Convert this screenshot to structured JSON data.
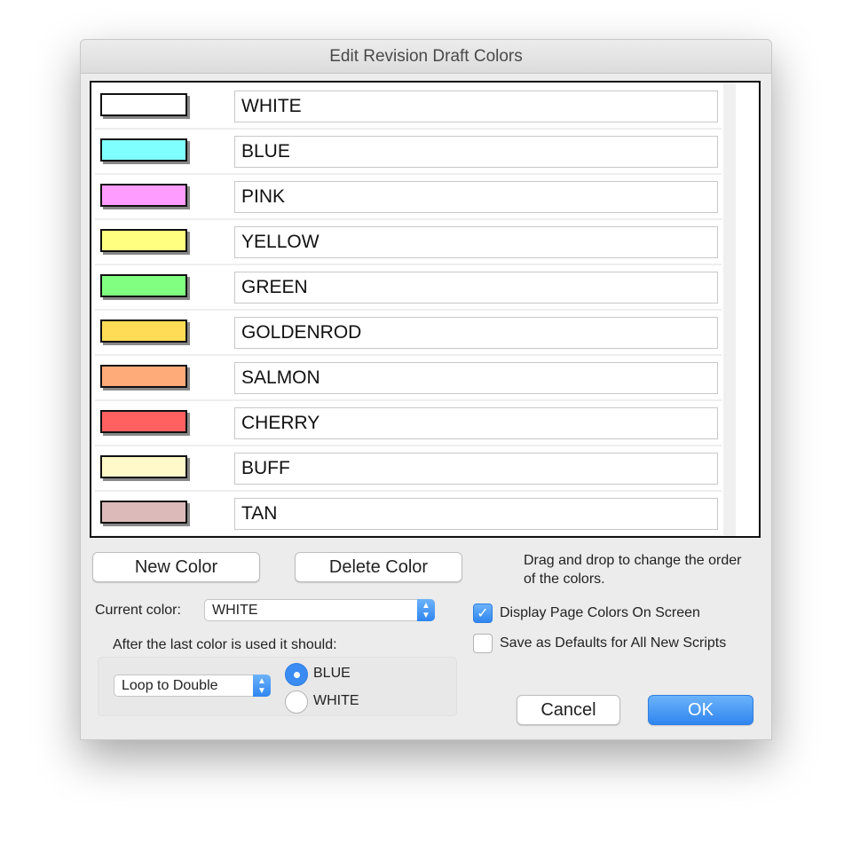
{
  "dialog": {
    "title": "Edit Revision Draft Colors"
  },
  "colors": [
    {
      "name": "WHITE",
      "swatch": "#ffffff"
    },
    {
      "name": "BLUE",
      "swatch": "#80ffff"
    },
    {
      "name": "PINK",
      "swatch": "#ff9cff"
    },
    {
      "name": "YELLOW",
      "swatch": "#ffff80"
    },
    {
      "name": "GREEN",
      "swatch": "#80ff80"
    },
    {
      "name": "GOLDENROD",
      "swatch": "#ffdc55"
    },
    {
      "name": "SALMON",
      "swatch": "#ffaa78"
    },
    {
      "name": "CHERRY",
      "swatch": "#ff6060"
    },
    {
      "name": "BUFF",
      "swatch": "#fff8c8"
    },
    {
      "name": "TAN",
      "swatch": "#dcbaba"
    }
  ],
  "buttons": {
    "new_color": "New Color",
    "delete_color": "Delete Color",
    "cancel": "Cancel",
    "ok": "OK"
  },
  "hint": "Drag and drop to change the order of the colors.",
  "current_color": {
    "label": "Current color:",
    "value": "WHITE"
  },
  "after_last": {
    "label": "After the last color is used it should:",
    "mode": "Loop to Double",
    "options": [
      {
        "label": "BLUE",
        "selected": true
      },
      {
        "label": "WHITE",
        "selected": false
      }
    ]
  },
  "checkboxes": [
    {
      "label": "Display Page Colors On Screen",
      "checked": true
    },
    {
      "label": "Save as Defaults for All New Scripts",
      "checked": false
    }
  ],
  "accent": "#2f85f0"
}
